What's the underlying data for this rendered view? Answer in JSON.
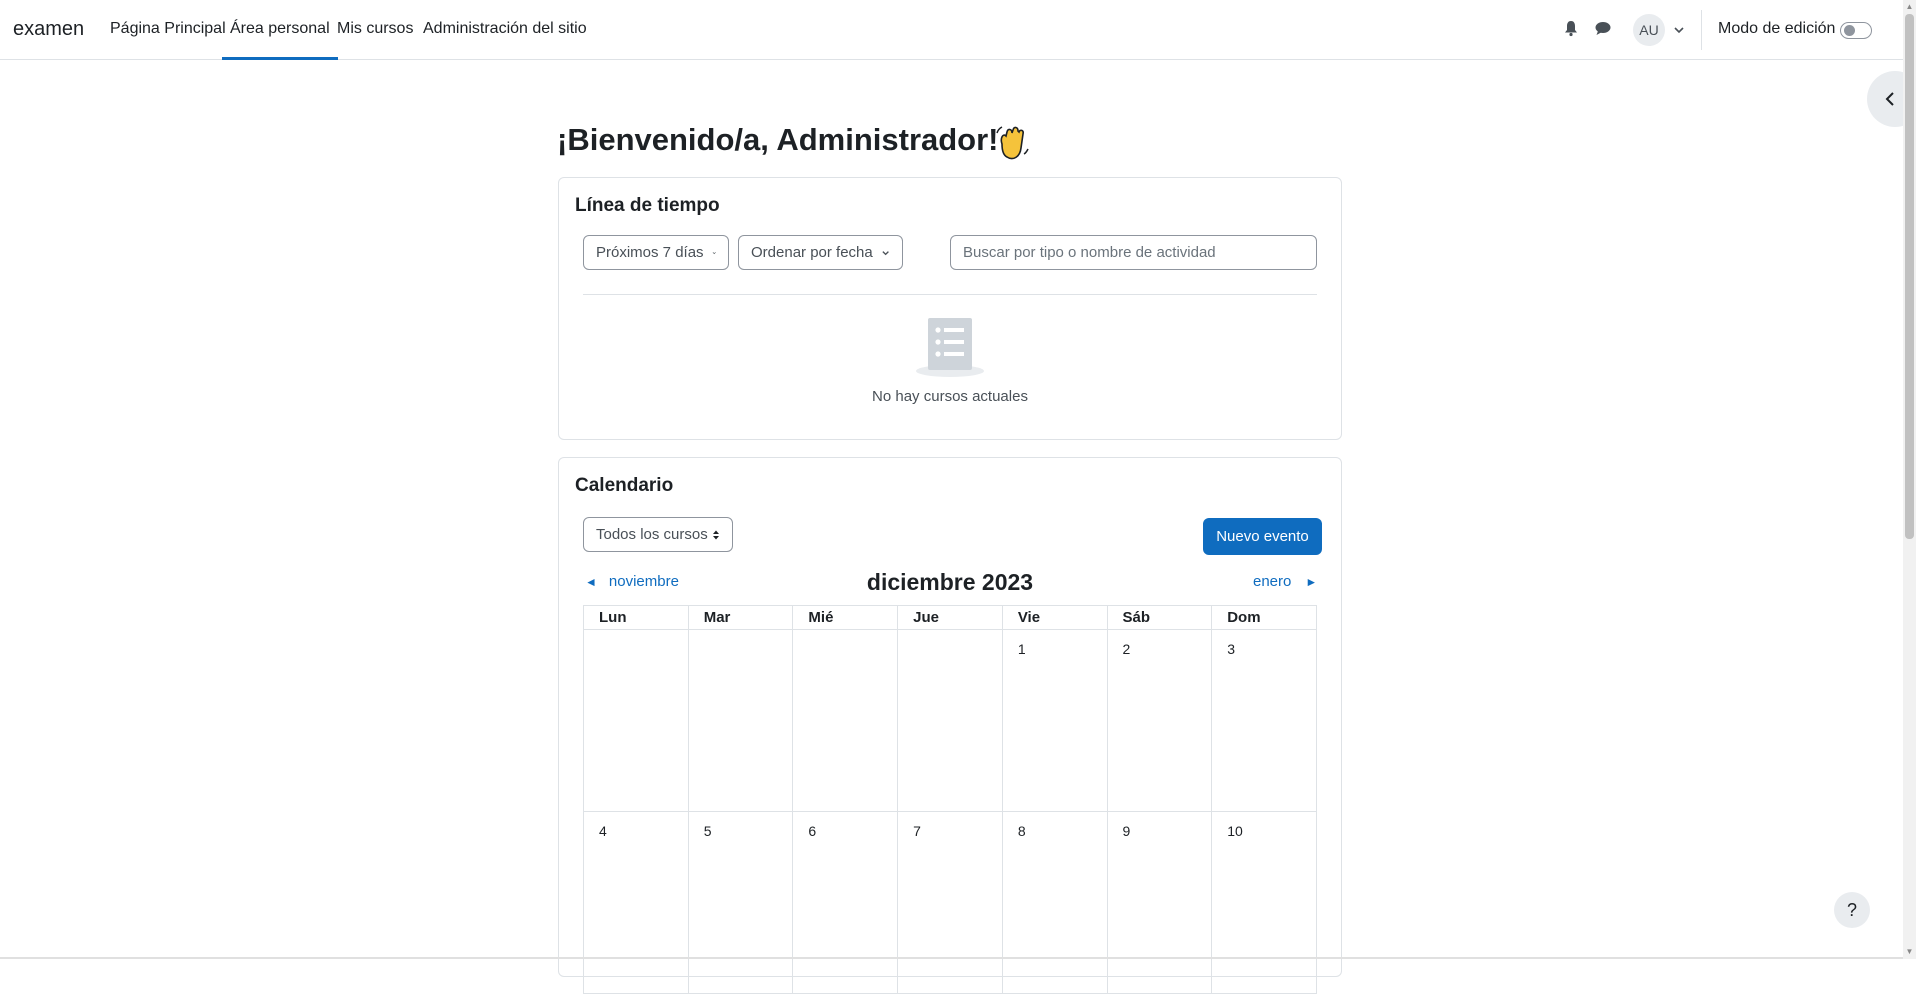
{
  "navbar": {
    "brand": "examen",
    "links": [
      {
        "label": "Página Principal"
      },
      {
        "label": "Área personal",
        "active": true
      },
      {
        "label": "Mis cursos"
      },
      {
        "label": "Administración del sitio"
      }
    ],
    "user_initials": "AU",
    "edit_mode_label": "Modo de edición",
    "edit_mode_on": false
  },
  "page": {
    "welcome": "¡Bienvenido/a, Administrador!"
  },
  "timeline": {
    "title": "Línea de tiempo",
    "filter_selected": "Próximos 7 días",
    "sort_selected": "Ordenar por fecha",
    "search_placeholder": "Buscar por tipo o nombre de actividad",
    "empty_message": "No hay cursos actuales"
  },
  "calendar": {
    "title": "Calendario",
    "course_filter_selected": "Todos los cursos",
    "new_event_label": "Nuevo evento",
    "prev_month": "noviembre",
    "current_month": "diciembre 2023",
    "next_month": "enero",
    "weekdays": [
      "Lun",
      "Mar",
      "Mié",
      "Jue",
      "Vie",
      "Sáb",
      "Dom"
    ],
    "weeks": [
      [
        "",
        "",
        "",
        "",
        "1",
        "2",
        "3"
      ],
      [
        "4",
        "5",
        "6",
        "7",
        "8",
        "9",
        "10"
      ]
    ]
  },
  "colors": {
    "accent": "#0f6cbf",
    "text": "#1d2125",
    "border": "#dee2e6"
  },
  "help_label": "?"
}
